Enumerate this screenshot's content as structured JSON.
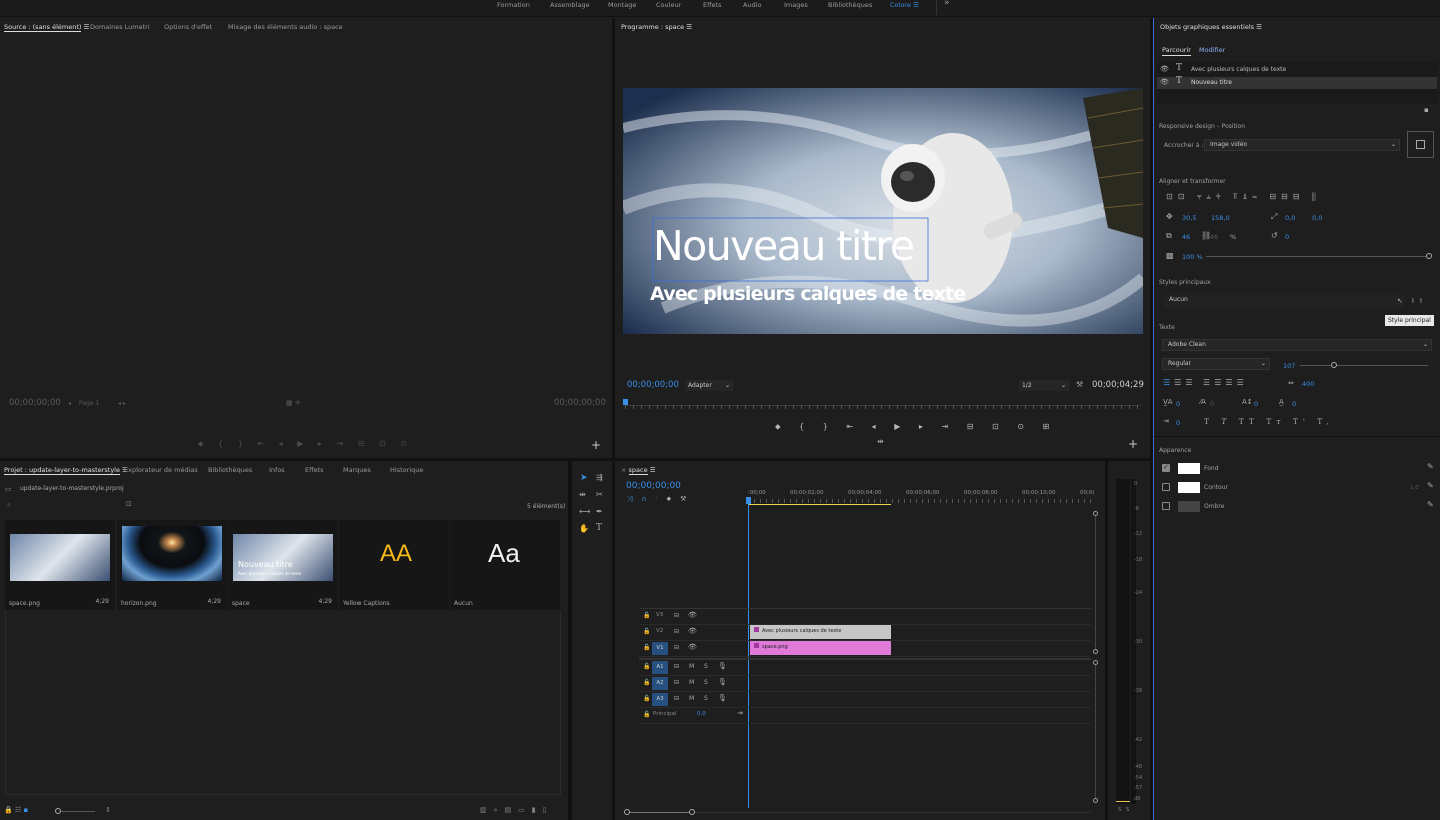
{
  "workspaces": [
    {
      "label": "Formation",
      "active": false
    },
    {
      "label": "Assemblage",
      "active": false
    },
    {
      "label": "Montage",
      "active": false
    },
    {
      "label": "Couleur",
      "active": false
    },
    {
      "label": "Effets",
      "active": false
    },
    {
      "label": "Audio",
      "active": false
    },
    {
      "label": "Images",
      "active": false
    },
    {
      "label": "Bibliothèques",
      "active": false
    },
    {
      "label": "Colore",
      "active": true
    }
  ],
  "workspace_more": "»",
  "source_panel": {
    "tabs": [
      "Source : (sans élément)",
      "Domaines Lumetri",
      "Options d'effet",
      "Mixage des éléments audio : space"
    ],
    "timecode_left": "00;00;00;00",
    "timecode_right": "00;00;00;00",
    "page_label": "Page 1"
  },
  "program_panel": {
    "title": "Programme : space",
    "timecode_left": "00;00;00;00",
    "fit_select": "Adapter",
    "resolution_select": "1/2",
    "timecode_right": "00;00;04;29",
    "video_title": "Nouveau titre",
    "video_subtitle": "Avec plusieurs calques de texte"
  },
  "project_panel": {
    "tabs": [
      "Projet : update-layer-to-masterstyle",
      "Explorateur de médias",
      "Bibliothèques",
      "Infos",
      "Effets",
      "Marques",
      "Historique"
    ],
    "file_name": "update-layer-to-masterstyle.prproj",
    "item_count": "5 élément(s)",
    "items": [
      {
        "name": "space.png",
        "duration": "4;29",
        "kind": "space"
      },
      {
        "name": "horizon.png",
        "duration": "4;29",
        "kind": "horizon"
      },
      {
        "name": "space",
        "duration": "4;29",
        "kind": "sequence"
      },
      {
        "name": "Yellow Captions",
        "duration": "",
        "kind": "yellow"
      },
      {
        "name": "Aucun",
        "duration": "",
        "kind": "aucun"
      }
    ],
    "thumb_title": "Nouveau titre",
    "thumb_subtitle": "Avec plusieurs calques de texte",
    "yellow_glyph": "AA",
    "aucun_glyph": "Aa"
  },
  "timeline_panel": {
    "tab": "space",
    "timecode": "00;00;00;00",
    "ruler": [
      ":00;00",
      "00;00;02;00",
      "00;00;04;00",
      "00;00;06;00",
      "00;00;08;00",
      "00;00;10;00",
      "00;0("
    ],
    "video_tracks": [
      {
        "name": "V3",
        "target": ""
      },
      {
        "name": "V2",
        "target": ""
      },
      {
        "name": "V1",
        "target": "V1"
      }
    ],
    "audio_tracks": [
      {
        "name": "A1",
        "target": "A1"
      },
      {
        "name": "A2",
        "target": "A2"
      },
      {
        "name": "A3",
        "target": "A3"
      }
    ],
    "master_label": "Principal",
    "master_value": "0,0",
    "clips": [
      {
        "label": "Avec plusieurs calques de texte",
        "track": "V2",
        "color": "#c8c5c9"
      },
      {
        "label": "space.png",
        "track": "V1",
        "color": "#e07ad9"
      }
    ]
  },
  "meter_labels": [
    "0",
    "-6",
    "-12",
    "-18",
    "-24",
    "-30",
    "-36",
    "-42",
    "-48",
    "-54",
    "-57",
    "dB"
  ],
  "meter_bottom": [
    "S",
    "S"
  ],
  "egp": {
    "title": "Objets graphiques essentiels",
    "tabs": [
      "Parcourir",
      "Modifier"
    ],
    "layers": [
      "Avec plusieurs calques de texte",
      "Nouveau titre"
    ],
    "responsive_label": "Responsive design – Position",
    "pin_label": "Accrocher à :",
    "pin_value": "Image vidéo",
    "align_label": "Aligner et transformer",
    "pos_x": "30,5",
    "pos_y": "158,0",
    "anchor_x": "0,0",
    "anchor_y": "0,0",
    "scale": "46",
    "scale_h": "46",
    "scale_unit": "%",
    "rotation": "0",
    "opacity": "100 %",
    "master_styles_label": "Styles principaux",
    "master_style_value": "Aucun",
    "tooltip": "Style principal",
    "text_label": "Texte",
    "font": "Adobe Clean",
    "font_style": "Regular",
    "font_size": "107",
    "tracking": "400",
    "kerning": "0",
    "leading": "0",
    "baseline": "0",
    "tsume": "0",
    "tab_width": "0",
    "appearance_label": "Apparence",
    "fill_label": "Fond",
    "stroke_label": "Contour",
    "stroke_value": "1,0",
    "shadow_label": "Ombre",
    "fill_checked": true,
    "fill_color": "#ffffff",
    "stroke_color": "#ffffff",
    "shadow_color": "#444444"
  }
}
